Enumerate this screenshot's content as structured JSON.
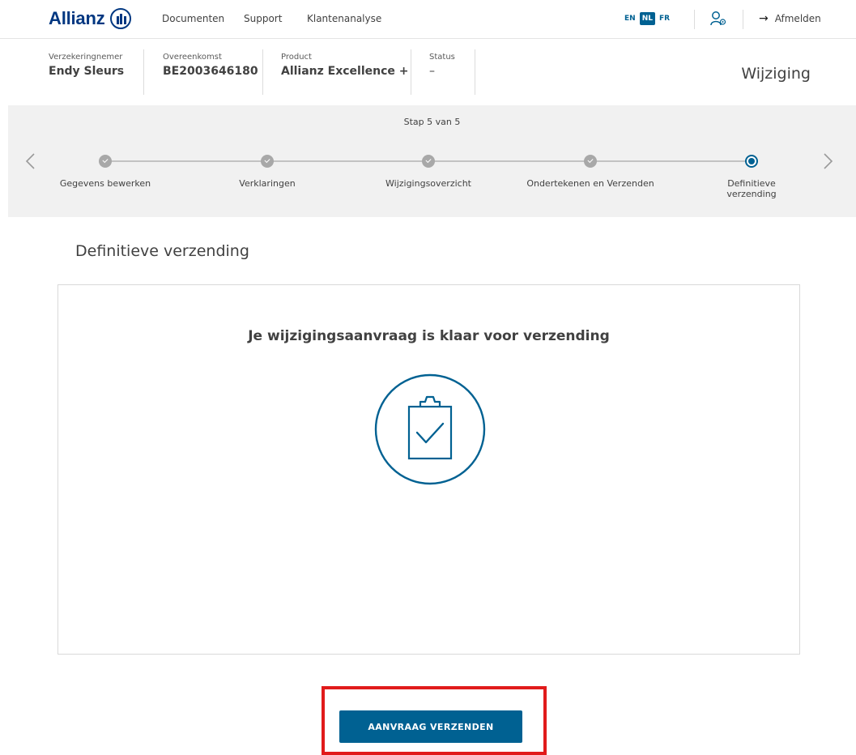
{
  "nav": {
    "logo_text": "Allianz",
    "links": [
      "Documenten",
      "Support",
      "Klantenanalyse"
    ],
    "languages": [
      {
        "code": "EN",
        "active": false
      },
      {
        "code": "NL",
        "active": true
      },
      {
        "code": "FR",
        "active": false
      }
    ],
    "user_icon": "user-settings-icon",
    "logout_label": "Afmelden",
    "logout_icon": "arrow-right-icon"
  },
  "contract": {
    "policyholder_label": "Verzekeringnemer",
    "policyholder_value": "Endy Sleurs",
    "agreement_label": "Overeenkomst",
    "agreement_value": "BE2003646180",
    "product_label": "Product",
    "product_value": "Allianz Excellence +",
    "status_label": "Status",
    "status_value": "–",
    "page_type": "Wijziging"
  },
  "stepper": {
    "counter": "Stap 5 van 5",
    "current_index": 4,
    "steps": [
      {
        "label": "Gegevens bewerken",
        "state": "done"
      },
      {
        "label": "Verklaringen",
        "state": "done"
      },
      {
        "label": "Wijzigingsoverzicht",
        "state": "done"
      },
      {
        "label": "Ondertekenen en Verzenden",
        "state": "done"
      },
      {
        "label": "Definitieve verzending",
        "state": "current"
      }
    ]
  },
  "main": {
    "section_title": "Definitieve verzending",
    "card_title": "Je wijzigingsaanvraag is klaar voor verzending",
    "card_icon": "clipboard-check-icon",
    "submit_label": "AANVRAAG VERZENDEN"
  },
  "colors": {
    "brand": "#003781",
    "accent": "#006192",
    "highlight": "#e11b1b",
    "stepper_bg": "#f1f1f1"
  }
}
